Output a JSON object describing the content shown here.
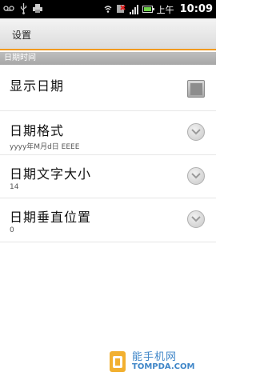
{
  "status_bar": {
    "left_icons": [
      "voicemail-icon",
      "usb-icon",
      "printer-icon"
    ],
    "right_icons": [
      "wifi-icon",
      "no-sim-icon",
      "signal-icon",
      "battery-icon"
    ],
    "ampm": "上午",
    "time": "10:09",
    "battery_color": "#6fd34a"
  },
  "title_bar": {
    "title": "设置",
    "accent": "#f29a1d"
  },
  "section": {
    "label": "日期时间"
  },
  "settings": [
    {
      "title": "显示日期",
      "subtitle": "",
      "control": "checkbox",
      "checked": true
    },
    {
      "title": "日期格式",
      "subtitle": "yyyy年M月d日 EEEE",
      "control": "chevron"
    },
    {
      "title": "日期文字大小",
      "subtitle": "14",
      "control": "chevron"
    },
    {
      "title": "日期垂直位置",
      "subtitle": "0",
      "control": "chevron"
    }
  ],
  "watermark": {
    "cn": "能手机网",
    "en": "TOMPDA.COM",
    "color": "#3f86c8"
  }
}
